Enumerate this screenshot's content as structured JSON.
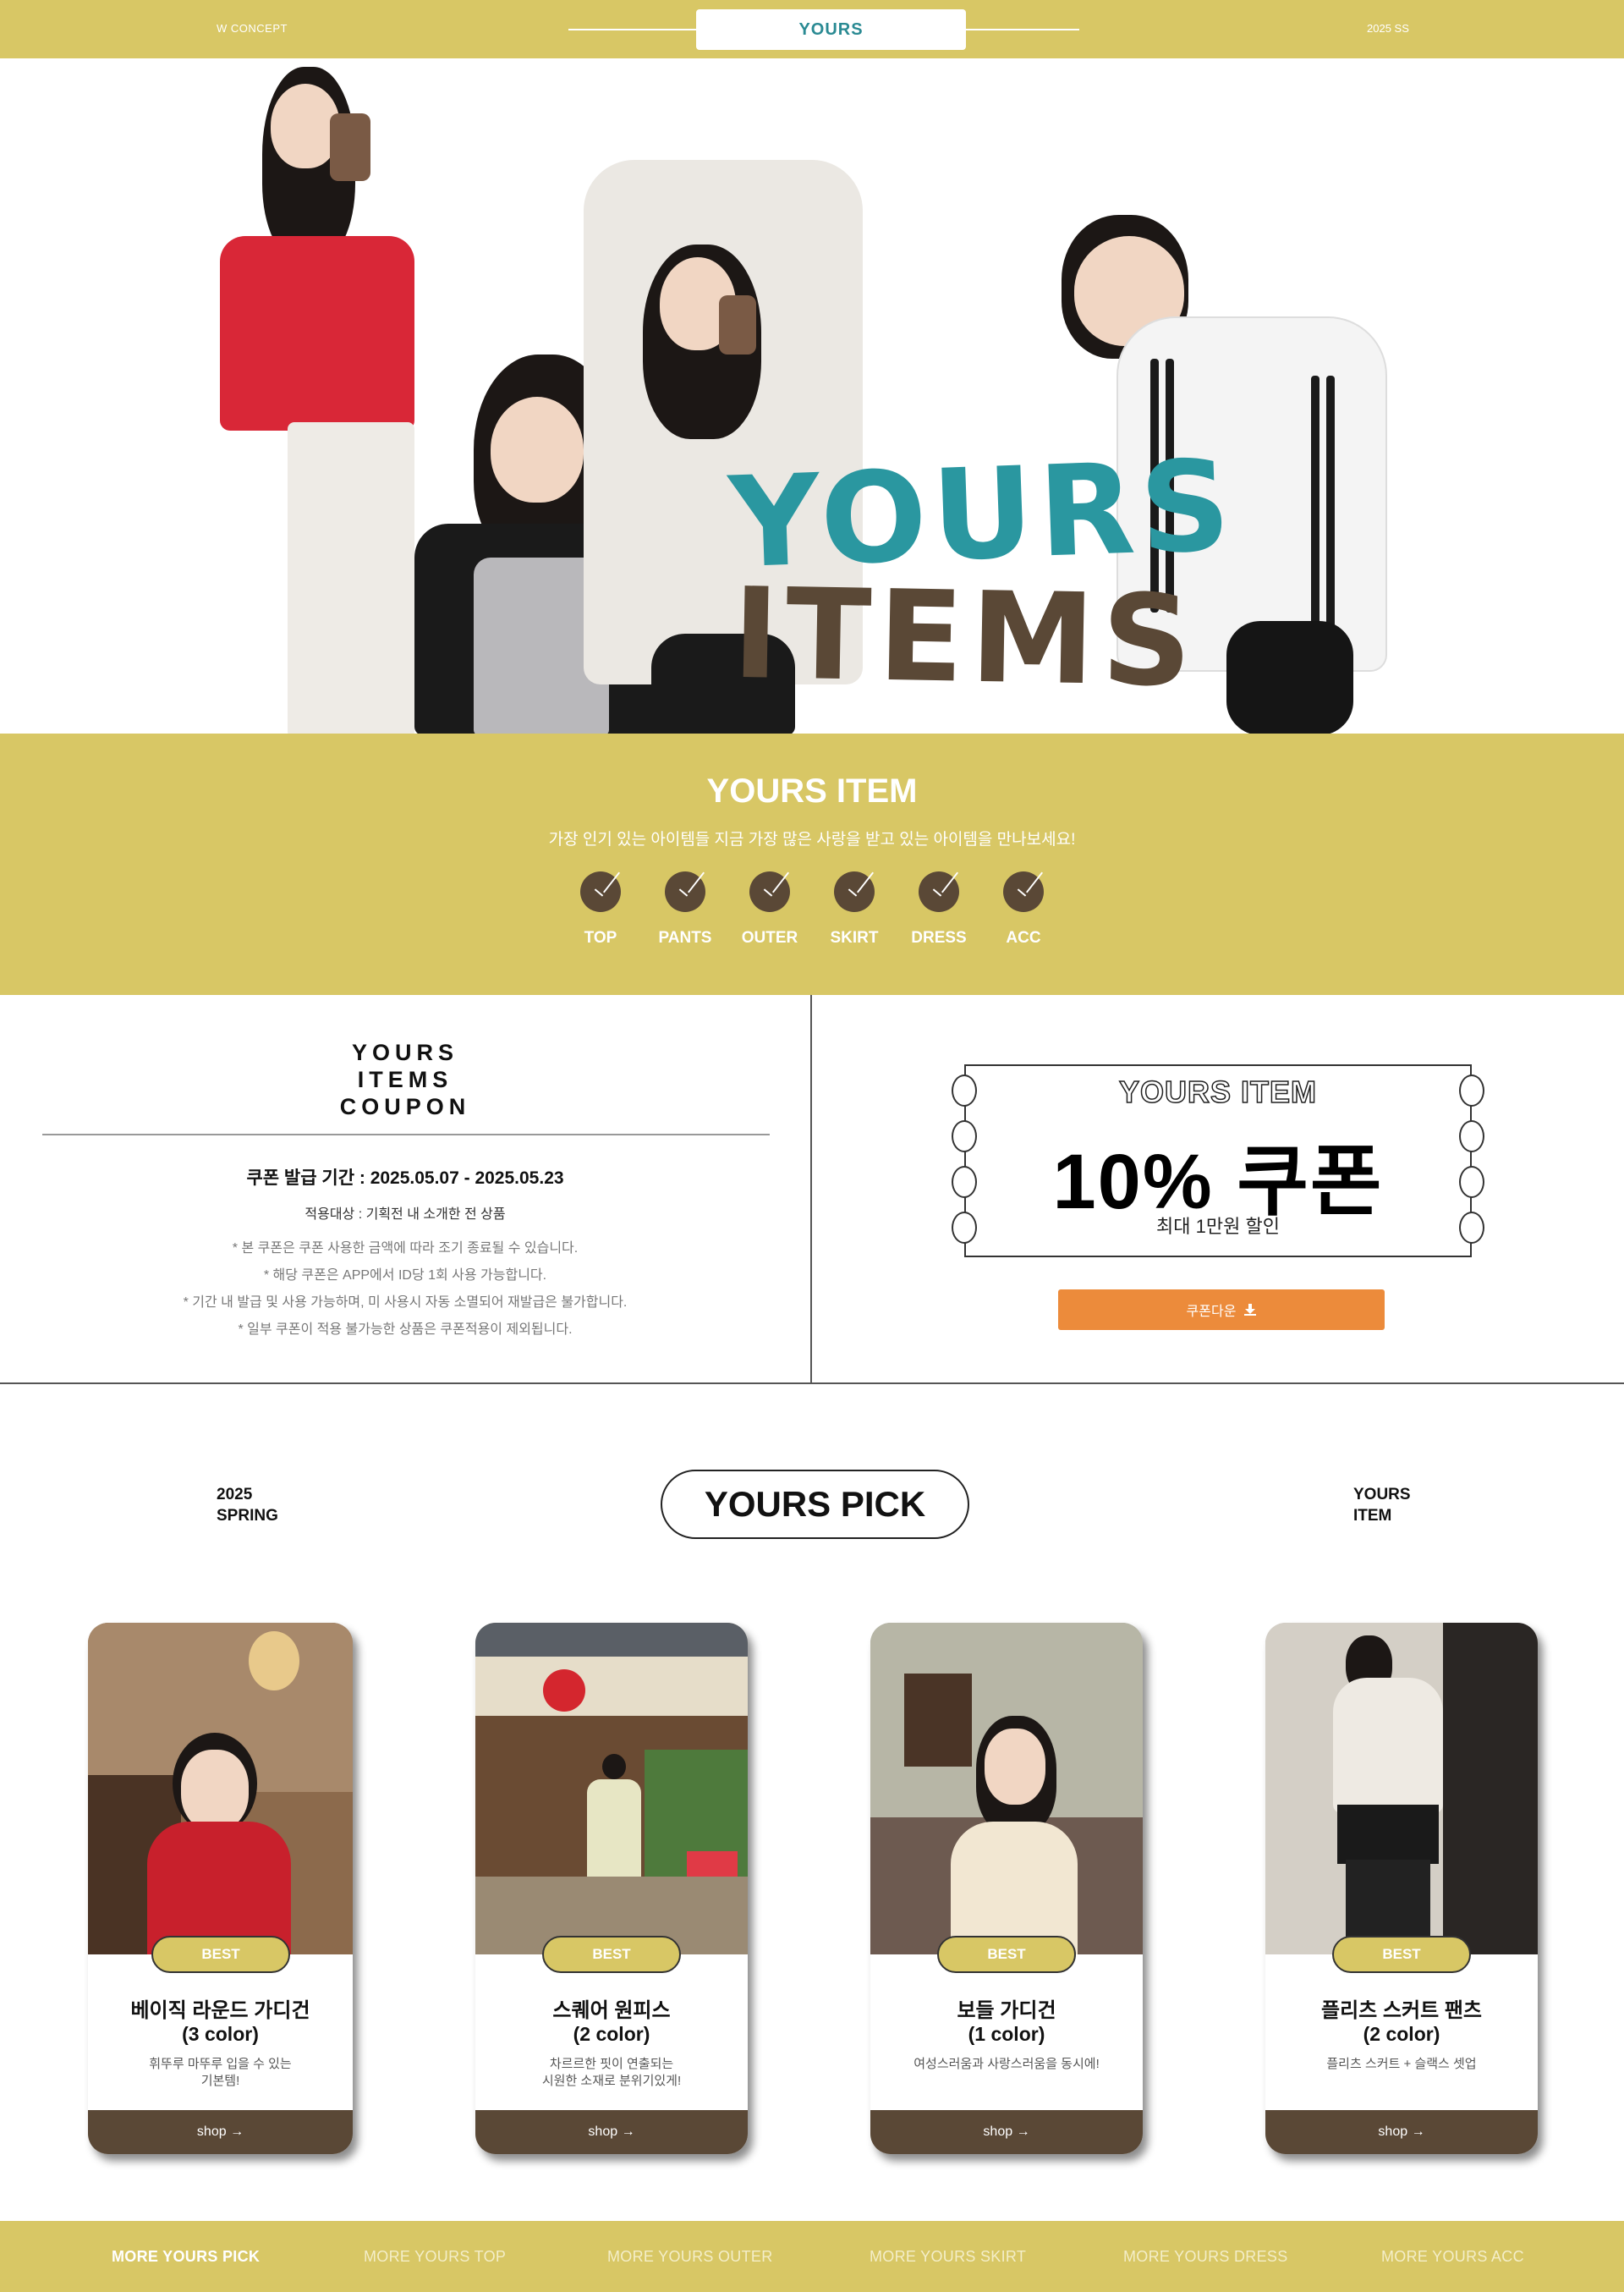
{
  "topbar": {
    "left_label": "W CONCEPT",
    "center_label": "YOURS",
    "right_label": "2025 SS"
  },
  "hero": {
    "title_line1": "YOURS",
    "title_line2": "ITEMS",
    "colors": {
      "title1": "#2a97a0",
      "title2": "#5a4836"
    }
  },
  "category_band": {
    "title": "YOURS ITEM",
    "subtitle": "가장 인기 있는 아이템들 지금 가장 많은 사랑을 받고 있는 아이템을 만나보세요!",
    "categories": [
      "TOP",
      "PANTS",
      "OUTER",
      "SKIRT",
      "DRESS",
      "ACC"
    ],
    "icon": "check-circle-icon"
  },
  "coupon": {
    "title_line1": "YOURS",
    "title_line2": "ITEMS",
    "title_line3": "COUPON",
    "period": "쿠폰 발급 기간 : 2025.05.07 - 2025.05.23",
    "target": "적용대상 : 기획전 내 소개한 전 상품",
    "notes": [
      "*  본 쿠폰은 쿠폰 사용한 금액에 따라 조기 종료될 수 있습니다.",
      "*  해당 쿠폰은 APP에서 ID당 1회 사용 가능합니다.",
      "*  기간 내 발급 및 사용 가능하며, 미 사용시 자동 소멸되어 재발급은 불가합니다.",
      "*  일부 쿠폰이 적용 불가능한 상품은 쿠폰적용이 제외됩니다."
    ],
    "ticket_header": "YOURS ITEM",
    "ticket_value": "10% 쿠폰",
    "ticket_sub": "최대 1만원 할인",
    "button_label": "쿠폰다운",
    "button_color": "#ec8b3b"
  },
  "pick": {
    "left_line1": "2025",
    "left_line2": "SPRING",
    "title": "YOURS PICK",
    "right_line1": "YOURS",
    "right_line2": "ITEM",
    "products": [
      {
        "badge": "BEST",
        "name": "베이직 라운드 가디건",
        "color": "(3 color)",
        "desc1": "휘뚜루 마뚜루 입을 수 있는",
        "desc2": "기본템!",
        "shop": "shop →"
      },
      {
        "badge": "BEST",
        "name": "스퀘어 원피스",
        "color": "(2 color)",
        "desc1": "차르르한 핏이 연출되는",
        "desc2": "시원한 소재로 분위기있게!",
        "shop": "shop →"
      },
      {
        "badge": "BEST",
        "name": "보들 가디건",
        "color": "(1 color)",
        "desc1": "여성스러움과 사랑스러움을 동시에!",
        "desc2": "",
        "shop": "shop →"
      },
      {
        "badge": "BEST",
        "name": "플리츠 스커트 팬츠",
        "color": "(2 color)",
        "desc1": "플리츠 스커트 + 슬랙스 셋업",
        "desc2": "",
        "shop": "shop →"
      }
    ]
  },
  "bottom_nav": {
    "items": [
      "MORE YOURS PICK",
      "MORE YOURS TOP",
      "MORE YOURS OUTER",
      "MORE YOURS SKIRT",
      "MORE YOURS DRESS",
      "MORE YOURS ACC"
    ],
    "active": "MORE YOURS PICK"
  },
  "brand_colors": {
    "mustard": "#d8c765",
    "brown": "#5a4836",
    "teal": "#2a8a93"
  }
}
